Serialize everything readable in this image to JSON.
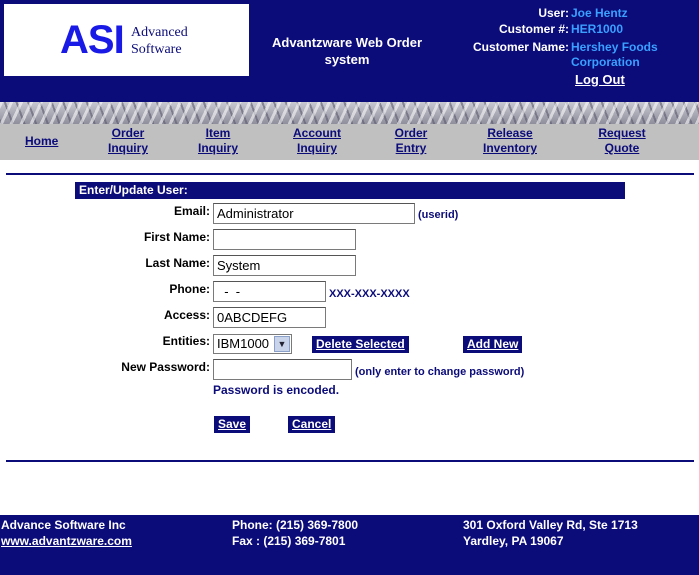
{
  "logo": {
    "mark": "ASI",
    "line1": "Advanced",
    "line2": "Software"
  },
  "header": {
    "title_line1": "Advantzware Web Order",
    "title_line2": "system",
    "user_label": "User:",
    "user_value": "Joe Hentz",
    "customer_no_label": "Customer #:",
    "customer_no_value": "HER1000",
    "customer_name_label": "Customer Name:",
    "customer_name_line1": "Hershey Foods",
    "customer_name_line2": "Corporation",
    "logout_label": "Log Out"
  },
  "nav": {
    "home": "Home",
    "order_inquiry": [
      "Order",
      "Inquiry"
    ],
    "item_inquiry": [
      "Item",
      "Inquiry"
    ],
    "account_inquiry": [
      "Account",
      "Inquiry"
    ],
    "order_entry": [
      "Order",
      "Entry"
    ],
    "release_inventory": [
      "Release",
      "Inventory"
    ],
    "request_quote": [
      "Request",
      "Quote"
    ]
  },
  "form": {
    "header": "Enter/Update User:",
    "email_label": "Email:",
    "email_value": "Administrator",
    "email_hint": "(userid)",
    "first_name_label": "First Name:",
    "first_name_value": "",
    "last_name_label": "Last Name:",
    "last_name_value": "System",
    "phone_label": "Phone:",
    "phone_value": "  -  -",
    "phone_hint": "XXX-XXX-XXXX",
    "access_label": "Access:",
    "access_value": "0ABCDEFG",
    "entities_label": "Entities:",
    "entities_selected": "IBM1000",
    "delete_selected_label": "Delete Selected",
    "add_new_label": "Add New",
    "new_password_label": "New Password:",
    "new_password_value": "",
    "new_password_hint": "(only enter to change password)",
    "password_note": "Password is encoded.",
    "save_label": "Save",
    "cancel_label": "Cancel"
  },
  "footer": {
    "company": "Advance Software Inc",
    "website": "www.advantzware.com",
    "phone": "Phone: (215) 369-7800",
    "fax": "Fax : (215) 369-7801",
    "address1": "301 Oxford Valley Rd, Ste 1713",
    "address2": "Yardley, PA 19067"
  },
  "colors": {
    "navy": "#0b0b7a",
    "link_blue": "#3aa0ff",
    "nav_gray": "#c0c0c0"
  }
}
